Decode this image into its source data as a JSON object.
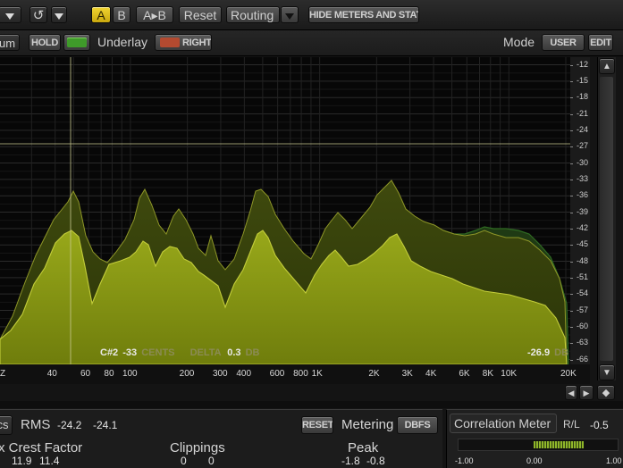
{
  "toolbar": {
    "a_label": "A",
    "b_label": "B",
    "copy_label": "A▸B",
    "reset_label": "Reset",
    "routing_label": "Routing",
    "hide_label": "HIDE METERS AND STATS"
  },
  "row2": {
    "tab_label": "um",
    "hold_label": "HOLD",
    "underlay_label": "Underlay",
    "right_label": "RIGHT",
    "mode_label": "Mode",
    "user_label": "USER",
    "edit_label": "EDIT"
  },
  "spectrum": {
    "db_ticks": [
      "-12",
      "-15",
      "-18",
      "-21",
      "-24",
      "-27",
      "-30",
      "-33",
      "-36",
      "-39",
      "-42",
      "-45",
      "-48",
      "-51",
      "-54",
      "-57",
      "-60",
      "-63",
      "-66"
    ],
    "freq_ticks": [
      "Z",
      "40",
      "60",
      "80",
      "100",
      "200",
      "300",
      "400",
      "600",
      "800",
      "1K",
      "2K",
      "3K",
      "4K",
      "6K",
      "8K",
      "10K",
      "20K"
    ],
    "cursor_note": "C#2",
    "cursor_cents": "-33",
    "cents_label": "CENTS",
    "delta_label": "DELTA",
    "delta_value": "0.3",
    "db_unit": "DB",
    "peak_readout": "-26.9",
    "colors": {
      "fill": "#8a9a12",
      "outline": "#b9c42a",
      "bg": "#070707"
    }
  },
  "levels": {
    "tab_label": "cs",
    "rms_label": "RMS",
    "rms_left": "-24.2",
    "rms_right": "-24.1",
    "reset_label": "RESET",
    "metering_label": "Metering",
    "dbfs_label": "DBFS",
    "crest_label": "x Crest Factor",
    "crest_left": "11.9",
    "crest_right": "11.4",
    "clippings_label": "Clippings",
    "clip_left": "0",
    "clip_right": "0",
    "peak_label": "Peak",
    "peak_left": "-1.8",
    "peak_right": "-0.8"
  },
  "correlation": {
    "title": "Correlation Meter",
    "mode_label": "R/L",
    "value": "-0.5",
    "scale_min": "-1.00",
    "scale_mid": "0.00",
    "scale_max": "1.00"
  }
}
